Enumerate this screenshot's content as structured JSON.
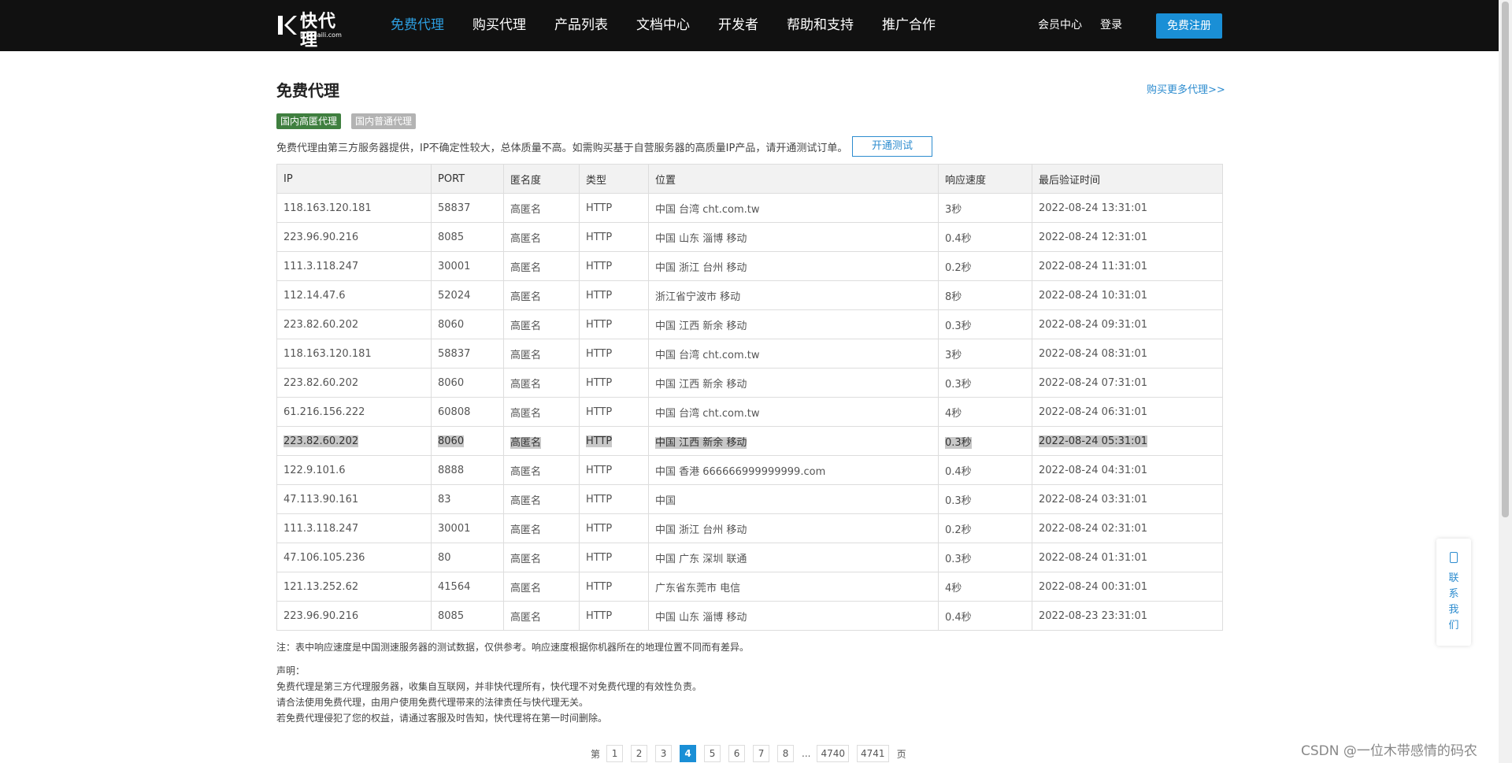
{
  "header": {
    "logo_text": "快代理",
    "logo_domain": "kuaidaili.com",
    "nav": [
      "免费代理",
      "购买代理",
      "产品列表",
      "文档中心",
      "开发者",
      "帮助和支持",
      "推广合作"
    ],
    "member_center": "会员中心",
    "login": "登录",
    "register": "免费注册"
  },
  "page": {
    "title": "免费代理",
    "buy_more": "购买更多代理>>",
    "tags": [
      "国内高匿代理",
      "国内普通代理"
    ],
    "notice": "免费代理由第三方服务器提供，IP不确定性较大，总体质量不高。如需购买基于自营服务器的高质量IP产品，请开通测试订单。",
    "trial_button": "开通测试"
  },
  "table": {
    "headers": [
      "IP",
      "PORT",
      "匿名度",
      "类型",
      "位置",
      "响应速度",
      "最后验证时间"
    ],
    "rows": [
      [
        "118.163.120.181",
        "58837",
        "高匿名",
        "HTTP",
        "中国 台湾 cht.com.tw",
        "3秒",
        "2022-08-24 13:31:01"
      ],
      [
        "223.96.90.216",
        "8085",
        "高匿名",
        "HTTP",
        "中国 山东 淄博 移动",
        "0.4秒",
        "2022-08-24 12:31:01"
      ],
      [
        "111.3.118.247",
        "30001",
        "高匿名",
        "HTTP",
        "中国 浙江 台州 移动",
        "0.2秒",
        "2022-08-24 11:31:01"
      ],
      [
        "112.14.47.6",
        "52024",
        "高匿名",
        "HTTP",
        "浙江省宁波市 移动",
        "8秒",
        "2022-08-24 10:31:01"
      ],
      [
        "223.82.60.202",
        "8060",
        "高匿名",
        "HTTP",
        "中国 江西 新余 移动",
        "0.3秒",
        "2022-08-24 09:31:01"
      ],
      [
        "118.163.120.181",
        "58837",
        "高匿名",
        "HTTP",
        "中国 台湾 cht.com.tw",
        "3秒",
        "2022-08-24 08:31:01"
      ],
      [
        "223.82.60.202",
        "8060",
        "高匿名",
        "HTTP",
        "中国 江西 新余 移动",
        "0.3秒",
        "2022-08-24 07:31:01"
      ],
      [
        "61.216.156.222",
        "60808",
        "高匿名",
        "HTTP",
        "中国 台湾 cht.com.tw",
        "4秒",
        "2022-08-24 06:31:01"
      ],
      [
        "223.82.60.202",
        "8060",
        "高匿名",
        "HTTP",
        "中国 江西 新余 移动",
        "0.3秒",
        "2022-08-24 05:31:01"
      ],
      [
        "122.9.101.6",
        "8888",
        "高匿名",
        "HTTP",
        "中国 香港 666666999999999.com",
        "0.4秒",
        "2022-08-24 04:31:01"
      ],
      [
        "47.113.90.161",
        "83",
        "高匿名",
        "HTTP",
        "中国",
        "0.3秒",
        "2022-08-24 03:31:01"
      ],
      [
        "111.3.118.247",
        "30001",
        "高匿名",
        "HTTP",
        "中国 浙江 台州 移动",
        "0.2秒",
        "2022-08-24 02:31:01"
      ],
      [
        "47.106.105.236",
        "80",
        "高匿名",
        "HTTP",
        "中国 广东 深圳 联通",
        "0.3秒",
        "2022-08-24 01:31:01"
      ],
      [
        "121.13.252.62",
        "41564",
        "高匿名",
        "HTTP",
        "广东省东莞市 电信",
        "4秒",
        "2022-08-24 00:31:01"
      ],
      [
        "223.96.90.216",
        "8085",
        "高匿名",
        "HTTP",
        "中国 山东 淄博 移动",
        "0.4秒",
        "2022-08-23 23:31:01"
      ]
    ],
    "selected_row": 8
  },
  "note": "注：表中响应速度是中国测速服务器的测试数据，仅供参考。响应速度根据你机器所在的地理位置不同而有差异。",
  "declaration": {
    "title": "声明：",
    "lines": [
      "免费代理是第三方代理服务器，收集自互联网，并非快代理所有，快代理不对免费代理的有效性负责。",
      "请合法使用免费代理，由用户使用免费代理带来的法律责任与快代理无关。",
      "若免费代理侵犯了您的权益，请通过客服及时告知，快代理将在第一时间删除。"
    ]
  },
  "pagination": {
    "prefix": "第",
    "pages": [
      "1",
      "2",
      "3",
      "4",
      "5",
      "6",
      "7",
      "8"
    ],
    "current": "4",
    "ellipsis": "...",
    "last_pages": [
      "4740",
      "4741"
    ],
    "suffix": "页"
  },
  "contact": {
    "icon": "phone-icon",
    "label": "联系我们"
  },
  "watermark": "CSDN @一位木带感情的码农",
  "colors": {
    "topbar": "#111111",
    "nav_active": "#2d9ee0",
    "primary": "#1a8fd6",
    "tag_high": "#3f7f3f",
    "tag_normal": "#b3b3b3"
  }
}
